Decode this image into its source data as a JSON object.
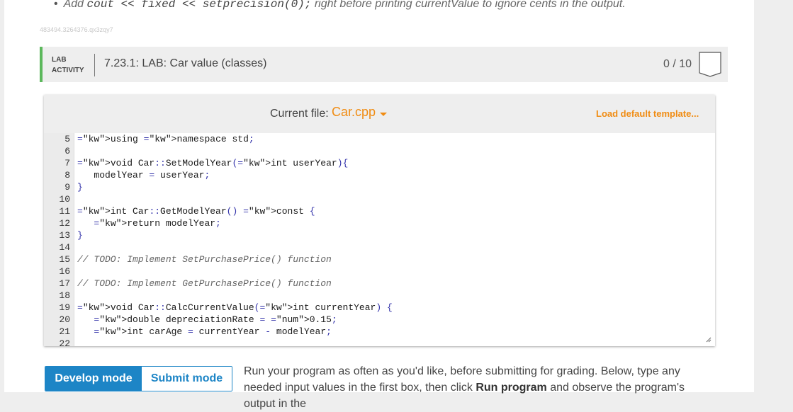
{
  "bullet": {
    "prefix": "Add",
    "code": "cout << fixed << setprecision(0);",
    "suffix": "right before printing currentValue to ignore cents in the output."
  },
  "section_id": "483494.3264376.qx3zqy7",
  "lab": {
    "label_line1": "LAB",
    "label_line2": "ACTIVITY",
    "title": "7.23.1: LAB: Car value (classes)",
    "score": "0 / 10"
  },
  "editor": {
    "current_file_label": "Current file:",
    "current_file": "Car.cpp",
    "load_template": "Load default template...",
    "lines": [
      {
        "n": "5",
        "text": "using namespace std;"
      },
      {
        "n": "6",
        "text": ""
      },
      {
        "n": "7",
        "text": "void Car::SetModelYear(int userYear){"
      },
      {
        "n": "8",
        "text": "   modelYear = userYear;"
      },
      {
        "n": "9",
        "text": "}"
      },
      {
        "n": "10",
        "text": ""
      },
      {
        "n": "11",
        "text": "int Car::GetModelYear() const {"
      },
      {
        "n": "12",
        "text": "   return modelYear;"
      },
      {
        "n": "13",
        "text": "}"
      },
      {
        "n": "14",
        "text": ""
      },
      {
        "n": "15",
        "text": "// TODO: Implement SetPurchasePrice() function"
      },
      {
        "n": "16",
        "text": ""
      },
      {
        "n": "17",
        "text": "// TODO: Implement GetPurchasePrice() function"
      },
      {
        "n": "18",
        "text": ""
      },
      {
        "n": "19",
        "text": "void Car::CalcCurrentValue(int currentYear) {"
      },
      {
        "n": "20",
        "text": "   double depreciationRate = 0.15;"
      },
      {
        "n": "21",
        "text": "   int carAge = currentYear - modelYear;"
      },
      {
        "n": "22",
        "text": ""
      }
    ]
  },
  "modes": {
    "develop": "Develop mode",
    "submit": "Submit mode"
  },
  "instructions": {
    "part1": "Run your program as often as you'd like, before submitting for grading. Below, type any needed input values in the first box, then click",
    "bold": "Run program",
    "part2": "and observe the program's output in the"
  },
  "colors": {
    "accent_orange": "#f08c13",
    "accent_blue": "#1d85c6",
    "lab_green": "#5cb85c"
  }
}
